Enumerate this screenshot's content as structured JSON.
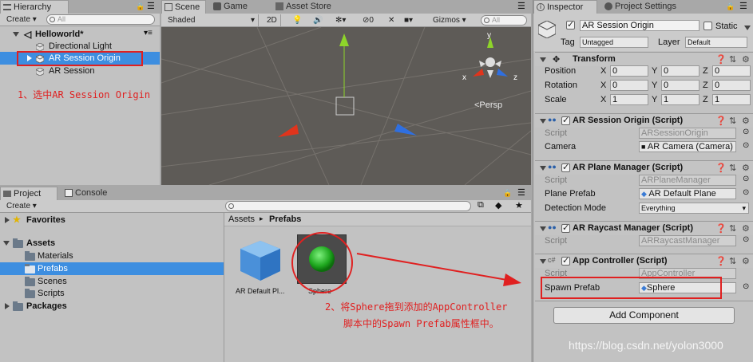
{
  "hierarchy": {
    "tab": "Hierarchy",
    "create": "Create",
    "search_placeholder": "All",
    "scene": "Helloworld*",
    "items": [
      "Directional Light",
      "AR Session Origin",
      "AR Session"
    ]
  },
  "scene_view": {
    "tabs": [
      "Scene",
      "Game",
      "Asset Store"
    ],
    "shading": "Shaded",
    "mode_2d": "2D",
    "fx_count": "0",
    "gizmos": "Gizmos",
    "search_placeholder": "All",
    "persp_label": "<Persp",
    "axis_x": "x",
    "axis_y": "y",
    "axis_z": "z"
  },
  "project": {
    "tabs": [
      "Project",
      "Console"
    ],
    "create": "Create",
    "favorites": "Favorites",
    "assets": "Assets",
    "folders": [
      "Materials",
      "Prefabs",
      "Scenes",
      "Scripts"
    ],
    "packages": "Packages",
    "breadcrumb_root": "Assets",
    "breadcrumb_sep": "▸",
    "breadcrumb_current": "Prefabs",
    "prefabs": [
      "AR Default Pl...",
      "Sphere"
    ]
  },
  "inspector": {
    "tabs": [
      "Inspector",
      "Project Settings"
    ],
    "object_name": "AR Session Origin",
    "static_label": "Static",
    "tag_label": "Tag",
    "tag_value": "Untagged",
    "layer_label": "Layer",
    "layer_value": "Default",
    "transform": {
      "title": "Transform",
      "rows": [
        {
          "label": "Position",
          "x": "0",
          "y": "0",
          "z": "0"
        },
        {
          "label": "Rotation",
          "x": "0",
          "y": "0",
          "z": "0"
        },
        {
          "label": "Scale",
          "x": "1",
          "y": "1",
          "z": "1"
        }
      ]
    },
    "ar_session_origin": {
      "title": "AR Session Origin (Script)",
      "script_label": "Script",
      "script_value": "ARSessionOrigin",
      "camera_label": "Camera",
      "camera_value": "AR Camera (Camera)"
    },
    "ar_plane_manager": {
      "title": "AR Plane Manager (Script)",
      "script_label": "Script",
      "script_value": "ARPlaneManager",
      "plane_prefab_label": "Plane Prefab",
      "plane_prefab_value": "AR Default Plane",
      "detection_label": "Detection Mode",
      "detection_value": "Everything"
    },
    "ar_raycast_manager": {
      "title": "AR Raycast Manager (Script)",
      "script_label": "Script",
      "script_value": "ARRaycastManager"
    },
    "app_controller": {
      "title": "App Controller (Script)",
      "script_label": "Script",
      "script_value": "AppController",
      "spawn_label": "Spawn Prefab",
      "spawn_value": "Sphere"
    },
    "add_component": "Add Component"
  },
  "annotations": {
    "step1": "1、选中AR Session Origin",
    "step2_line1": "2、将Sphere拖到添加的AppController",
    "step2_line2": "脚本中的Spawn Prefab属性框中。"
  },
  "watermark": "https://blog.csdn.net/yolon3000",
  "colors": {
    "annotation_red": "#e02020",
    "selection_blue": "#3d8ee0",
    "scene_bg": "#5e5b57"
  }
}
